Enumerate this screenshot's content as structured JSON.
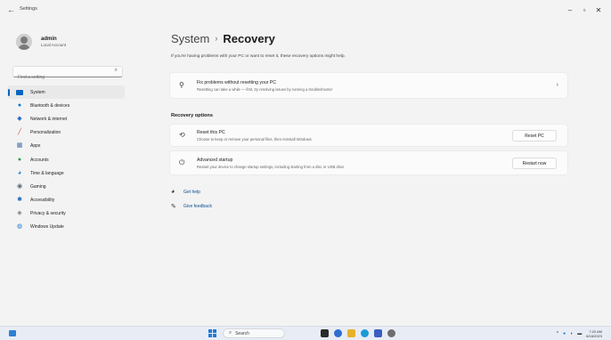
{
  "window": {
    "title": "Settings",
    "back_icon": "back-arrow-icon",
    "controls": {
      "minimize": "–",
      "maximize": "▫",
      "close": "✕"
    }
  },
  "profile": {
    "name": "admin",
    "subtitle": "Local Account"
  },
  "search": {
    "placeholder": "Find a setting"
  },
  "nav": [
    {
      "label": "System",
      "icon": "system-icon",
      "active": true,
      "color": "#0067c0"
    },
    {
      "label": "Bluetooth & devices",
      "icon": "bluetooth-icon",
      "color": "#0078d4"
    },
    {
      "label": "Network & internet",
      "icon": "network-icon",
      "color": "#2a6fcf"
    },
    {
      "label": "Personalization",
      "icon": "brush-icon",
      "color": "#c05a2b"
    },
    {
      "label": "Apps",
      "icon": "apps-icon",
      "color": "#4a6fa5"
    },
    {
      "label": "Accounts",
      "icon": "accounts-icon",
      "color": "#2e9b58"
    },
    {
      "label": "Time & language",
      "icon": "time-language-icon",
      "color": "#1c7fc9"
    },
    {
      "label": "Gaming",
      "icon": "gaming-icon",
      "color": "#5a6773"
    },
    {
      "label": "Accessibility",
      "icon": "accessibility-icon",
      "color": "#1a62b8"
    },
    {
      "label": "Privacy & security",
      "icon": "shield-icon",
      "color": "#6d7782"
    },
    {
      "label": "Windows Update",
      "icon": "windows-update-icon",
      "color": "#1a7ad6"
    }
  ],
  "main": {
    "breadcrumb_parent": "System",
    "breadcrumb_sep": "›",
    "breadcrumb_current": "Recovery",
    "intro": "If you're having problems with your PC or want to reset it, these recovery options might help.",
    "fix_card": {
      "title": "Fix problems without resetting your PC",
      "desc": "Resetting can take a while — first, try resolving issues by running a troubleshooter"
    },
    "section_title": "Recovery options",
    "reset_card": {
      "title": "Reset this PC",
      "desc": "Choose to keep or remove your personal files, then reinstall Windows",
      "button": "Reset PC"
    },
    "advanced_card": {
      "title": "Advanced startup",
      "desc": "Restart your device to change startup settings, including starting from a disc or USB drive",
      "button": "Restart now"
    },
    "links": {
      "help": "Get help",
      "feedback": "Give feedback"
    }
  },
  "taskbar": {
    "search_label": "Search",
    "apps": [
      {
        "name": "task-view",
        "color": "#2b2b2b"
      },
      {
        "name": "chat",
        "color": "#2f6fd1"
      },
      {
        "name": "file-explorer",
        "color": "#e8b02a"
      },
      {
        "name": "edge",
        "color": "#1a9ad6"
      },
      {
        "name": "store",
        "color": "#3b5fc0"
      },
      {
        "name": "settings",
        "color": "#6e6e6e"
      }
    ],
    "time": "7:20 AM",
    "date": "6/16/2023"
  }
}
